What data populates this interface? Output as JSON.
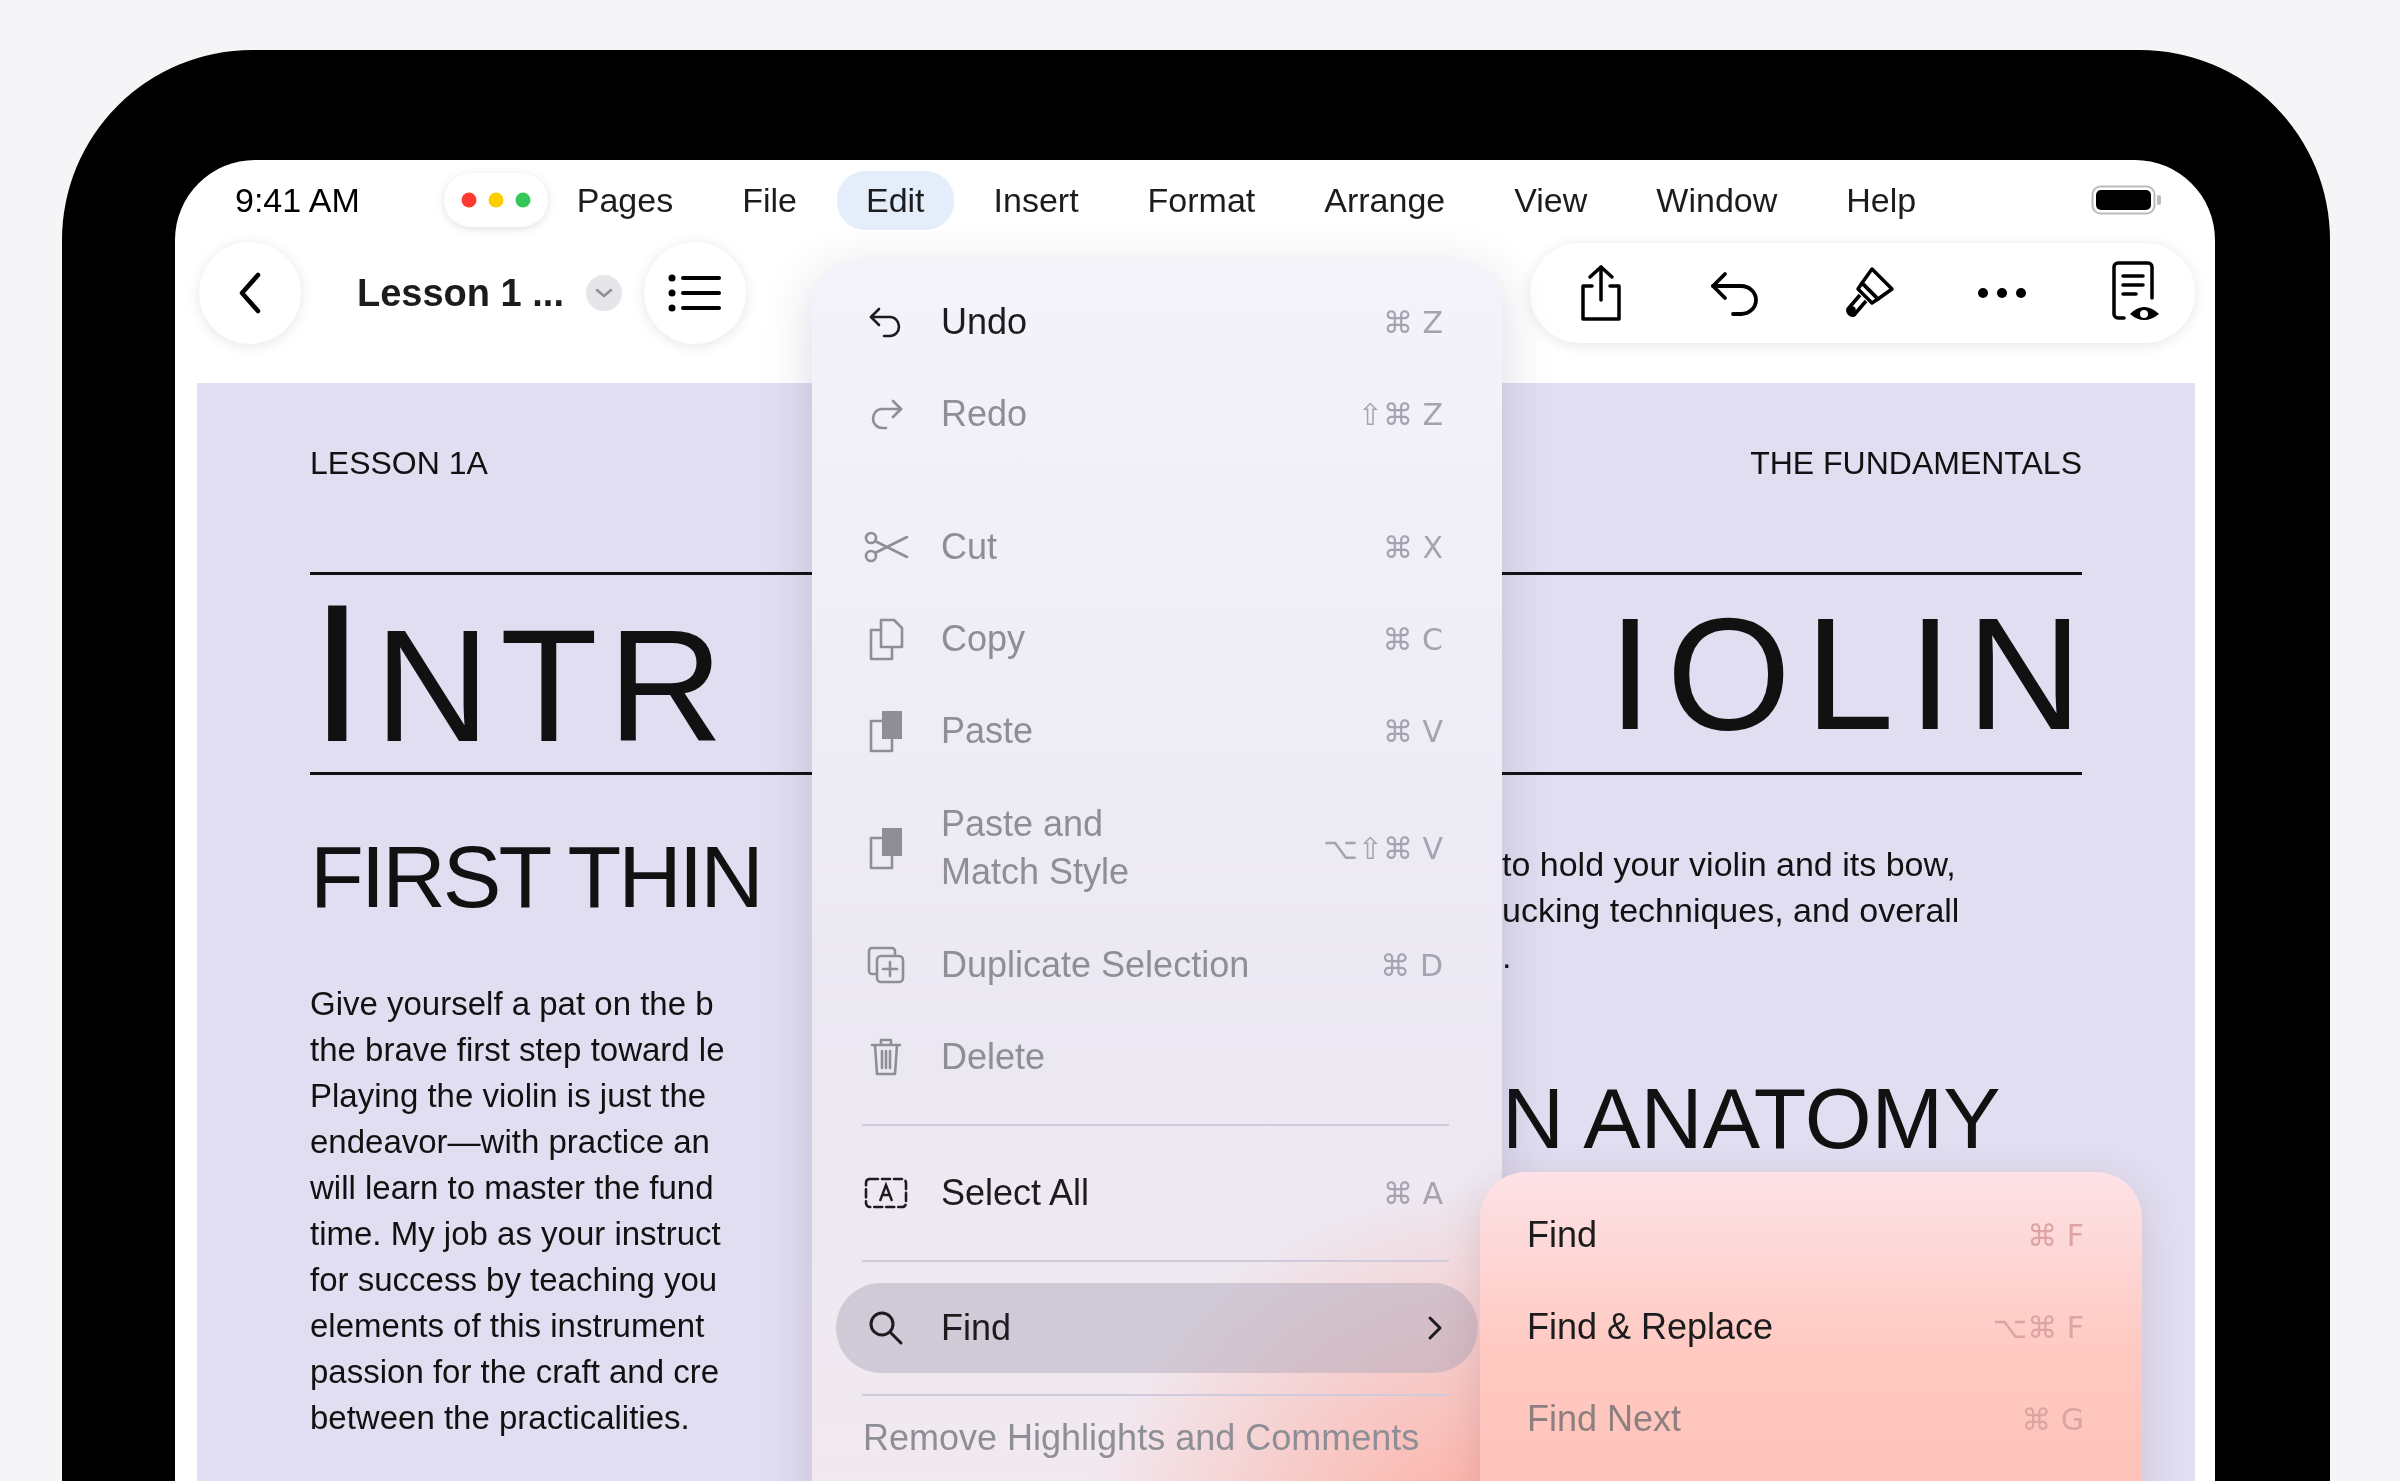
{
  "status_bar": {
    "time": "9:41 AM"
  },
  "menu_bar": {
    "items": [
      {
        "label": "Pages",
        "selected": false
      },
      {
        "label": "File",
        "selected": false
      },
      {
        "label": "Edit",
        "selected": true
      },
      {
        "label": "Insert",
        "selected": false
      },
      {
        "label": "Format",
        "selected": false
      },
      {
        "label": "Arrange",
        "selected": false
      },
      {
        "label": "View",
        "selected": false
      },
      {
        "label": "Window",
        "selected": false
      },
      {
        "label": "Help",
        "selected": false
      }
    ]
  },
  "toolbar": {
    "document_title": "Lesson 1 ..."
  },
  "document": {
    "header_left": "LESSON 1A",
    "header_right": "THE FUNDAMENTALS",
    "title_left": "INTR",
    "title_right": "IOLIN",
    "heading_left": "FIRST THIN",
    "body_left": [
      "Give yourself a pat on the b",
      "the brave first step toward le",
      "Playing the violin is just the",
      "endeavor—with practice an",
      "will learn to master the fund",
      "time. My job as your instruct",
      "for success by teaching you",
      "elements of this instrument",
      "passion for the craft and cre",
      "between the practicalities."
    ],
    "body_right": [
      "to hold your violin and its bow,",
      "ucking techniques, and overall",
      "."
    ],
    "heading_right": "N ANATOMY"
  },
  "edit_menu": {
    "items": [
      {
        "kind": "action",
        "label": "Undo",
        "shortcut": "⌘ Z",
        "disabled": false,
        "selected": false
      },
      {
        "kind": "action",
        "label": "Redo",
        "shortcut": "⇧⌘ Z",
        "disabled": true,
        "selected": false
      },
      {
        "kind": "gap"
      },
      {
        "kind": "action",
        "label": "Cut",
        "shortcut": "⌘ X",
        "disabled": true,
        "selected": false
      },
      {
        "kind": "action",
        "label": "Copy",
        "shortcut": "⌘ C",
        "disabled": true,
        "selected": false
      },
      {
        "kind": "action",
        "label": "Paste",
        "shortcut": "⌘ V",
        "disabled": true,
        "selected": false
      },
      {
        "kind": "action",
        "label": "Paste and Match Style",
        "shortcut": "⌥⇧⌘ V",
        "disabled": true,
        "selected": false
      },
      {
        "kind": "action",
        "label": "Duplicate Selection",
        "shortcut": "⌘ D",
        "disabled": true,
        "selected": false
      },
      {
        "kind": "action",
        "label": "Delete",
        "disabled": true,
        "selected": false
      },
      {
        "kind": "separator"
      },
      {
        "kind": "action",
        "label": "Select All",
        "shortcut": "⌘ A",
        "disabled": false,
        "selected": false
      },
      {
        "kind": "separator"
      },
      {
        "kind": "submenu",
        "label": "Find",
        "disabled": false,
        "selected": true
      },
      {
        "kind": "separator"
      },
      {
        "kind": "action",
        "label": "Remove Highlights and Comments",
        "disabled": true,
        "selected": false
      }
    ]
  },
  "find_submenu": {
    "items": [
      {
        "label": "Find",
        "shortcut": "⌘ F",
        "disabled": false
      },
      {
        "label": "Find & Replace",
        "shortcut": "⌥⌘ F",
        "disabled": false
      },
      {
        "label": "Find Next",
        "shortcut": "⌘ G",
        "disabled": true
      }
    ]
  }
}
